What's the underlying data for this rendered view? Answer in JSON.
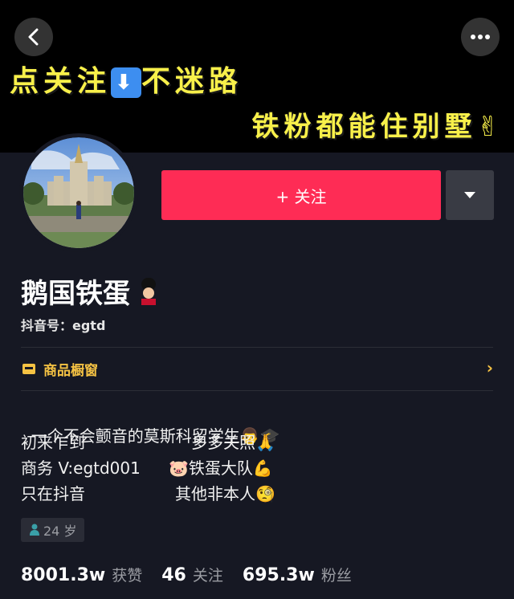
{
  "banner": {
    "line1": "点关注",
    "line1_suffix": "不迷路",
    "line2": "铁粉都能住别墅",
    "line1_emoji_icon": "down-arrow-emoji-icon",
    "line2_emoji_icon": "victory-hand-emoji-icon"
  },
  "header": {
    "back_icon": "chevron-left-icon",
    "more_icon": "more-dots-icon"
  },
  "actions": {
    "follow_label": "+ 关注",
    "dropdown_icon": "caret-down-icon"
  },
  "profile": {
    "nickname": "鹅国铁蛋",
    "nickname_emoji": "guardsman-emoji-icon",
    "douyin_id": "抖音号：egtd"
  },
  "shop": {
    "label": "商品橱窗",
    "icon": "shop-icon"
  },
  "bio": {
    "line1": "一个不会颤音的莫斯科留学生",
    "line2_left": "初来乍到",
    "line2_right": "多多关照",
    "line3_left": "商务 V:egtd001",
    "line3_right": "铁蛋大队",
    "line4_left": "只在抖音",
    "line4_right": "其他非本人"
  },
  "age": {
    "label": "24 岁",
    "icon": "person-icon"
  },
  "stats": {
    "likes_value": "8001.3w",
    "likes_label": "获赞",
    "following_value": "46",
    "following_label": "关注",
    "fans_value": "695.3w",
    "fans_label": "粉丝"
  },
  "colors": {
    "background": "#161823",
    "accent": "#fe2c55",
    "banner_text": "#f8f04a",
    "shop": "#f5c243"
  }
}
